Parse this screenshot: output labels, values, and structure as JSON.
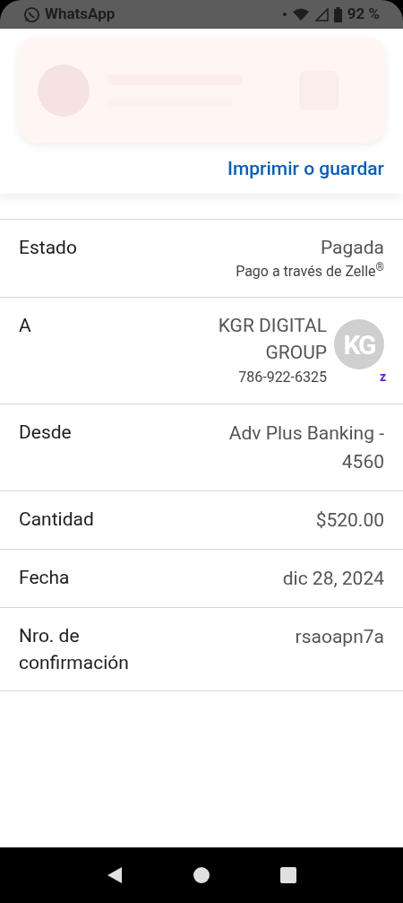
{
  "status_bar": {
    "app": "WhatsApp",
    "battery": "92 %"
  },
  "print_link": "Imprimir o guardar",
  "details": [
    {
      "kind": "status",
      "label": "Estado",
      "value": "Pagada",
      "note": "Pago a través de Zelle$^{®}$"
    },
    {
      "kind": "recipient",
      "label": "A",
      "value": "KGR DIGITAL GROUP",
      "note": "786-922-6325",
      "avatar": "KG",
      "badge": "z"
    },
    {
      "kind": "plain",
      "label": "Desde",
      "value": "Adv Plus Banking - 4560"
    },
    {
      "kind": "plain",
      "label": "Cantidad",
      "value": "$520.00"
    },
    {
      "kind": "plain",
      "label": "Fecha",
      "value": "dic 28, 2024"
    },
    {
      "kind": "plain",
      "label": "Nro. de confirmación",
      "value": "rsaoapn7a"
    }
  ]
}
